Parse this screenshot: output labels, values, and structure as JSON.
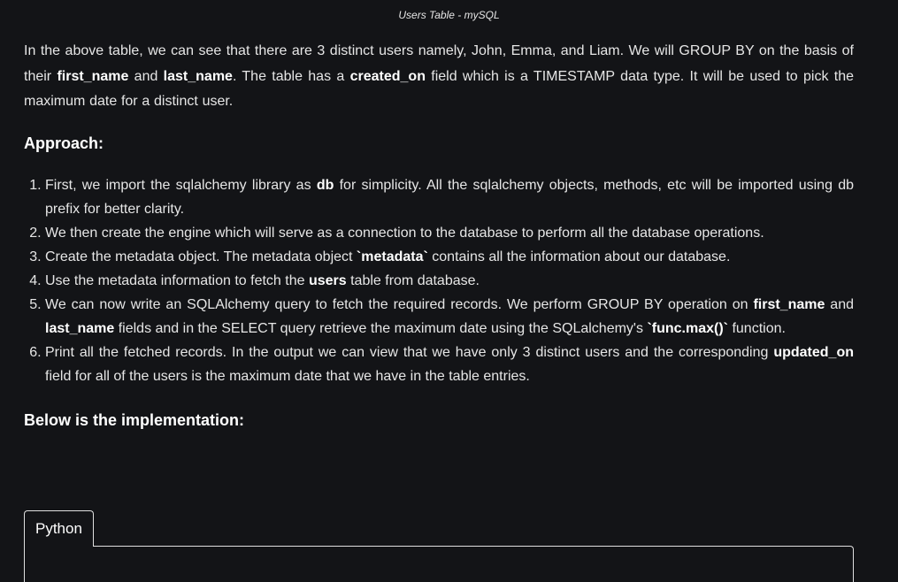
{
  "caption": "Users Table - mySQL",
  "intro": {
    "t1": "In the above table, we can see that there are 3 distinct users namely, John, Emma, and Liam. We will GROUP BY on the basis of their ",
    "b1": "first_name",
    "t2": " and ",
    "b2": "last_name",
    "t3": ". The table has a ",
    "b3": "created_on",
    "t4": " field which is a TIMESTAMP data type. It will be used to pick the maximum date for a distinct user."
  },
  "approach_heading": "Approach:",
  "steps": [
    {
      "t1": "First, we import the sqlalchemy library as ",
      "b1": "db",
      "t2": " for simplicity. All the sqlalchemy objects, methods, etc will be imported using db prefix for better clarity."
    },
    {
      "t1": "We then create the engine which will serve as a connection to the database to perform all the database operations."
    },
    {
      "t1": "Create the metadata object. The metadata object ",
      "b1": "`metadata`",
      "t2": " contains all the information about our database."
    },
    {
      "t1": "Use the metadata information to fetch the ",
      "b1": "users",
      "t2": " table from database."
    },
    {
      "t1": "We can now write an SQLAlchemy query to fetch the required records. We perform GROUP BY operation on ",
      "b1": "first_name",
      "t2": " and ",
      "b2": "last_name",
      "t3": " fields and in the SELECT query retrieve the maximum date using the SQLalchemy's ",
      "b3": "`func.max()`",
      "t4": " function."
    },
    {
      "t1": "Print all the fetched records. In the output we can view that we have only 3 distinct users and the corresponding ",
      "b1": "updated_on",
      "t2": " field for all of the users is the maximum date that we have in the table entries."
    }
  ],
  "impl_heading": "Below is the implementation:",
  "tabs": {
    "python": "Python"
  }
}
